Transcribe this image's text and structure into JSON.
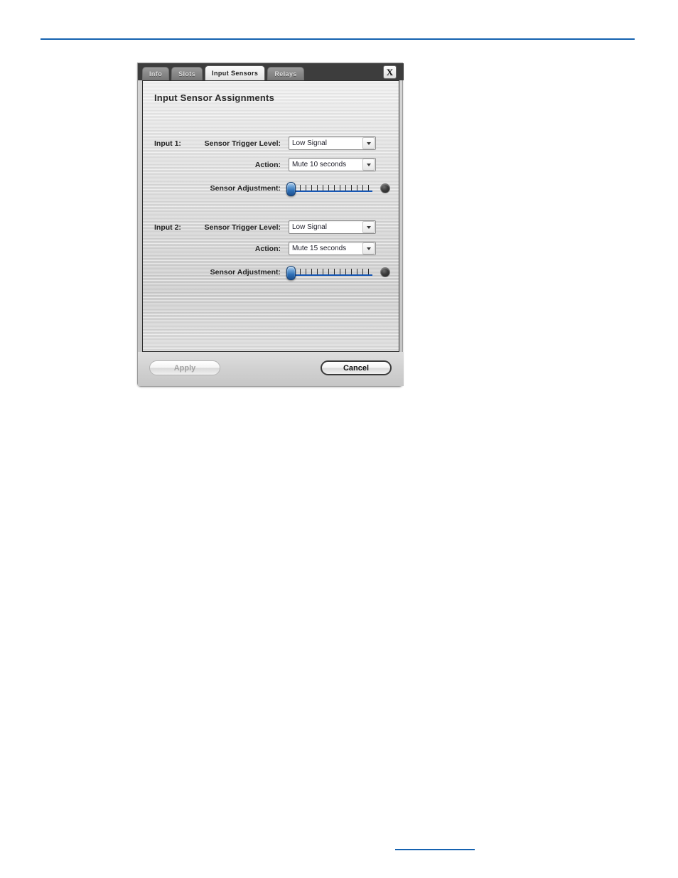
{
  "dialog": {
    "close_label": "X",
    "panel_title": "Input Sensor Assignments",
    "tabs": [
      {
        "label": "Info",
        "active": false
      },
      {
        "label": "Slots",
        "active": false
      },
      {
        "label": "Input Sensors",
        "active": true
      },
      {
        "label": "Relays",
        "active": false
      }
    ],
    "inputs": [
      {
        "name": "Input 1:",
        "trigger_label": "Sensor Trigger Level:",
        "trigger_value": "Low Signal",
        "action_label": "Action:",
        "action_value": "Mute 10 seconds",
        "adjustment_label": "Sensor Adjustment:",
        "adjustment_percent": 0,
        "led_state": "off"
      },
      {
        "name": "Input 2:",
        "trigger_label": "Sensor Trigger Level:",
        "trigger_value": "Low Signal",
        "action_label": "Action:",
        "action_value": "Mute 15 seconds",
        "adjustment_label": "Sensor Adjustment:",
        "adjustment_percent": 0,
        "led_state": "off"
      }
    ],
    "footer": {
      "apply_label": "Apply",
      "apply_enabled": false,
      "cancel_label": "Cancel",
      "cancel_enabled": true
    }
  },
  "colors": {
    "accent_blue": "#1562b0",
    "slider_blue": "#1757b5",
    "tab_bar": "#3d3d3d",
    "text_dark": "#232323"
  }
}
